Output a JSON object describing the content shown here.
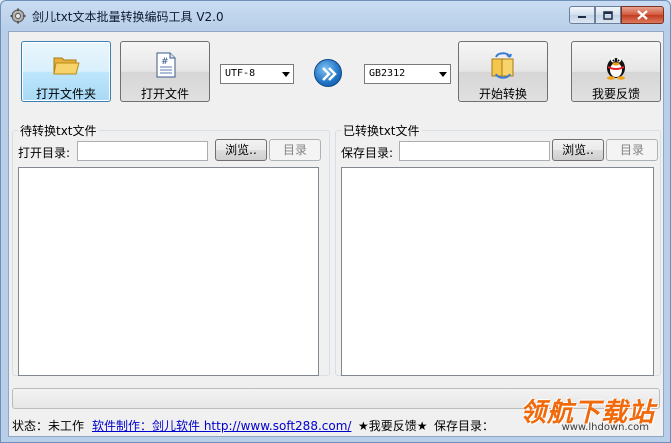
{
  "window": {
    "title": "剑儿txt文本批量转换编码工具 V2.0"
  },
  "toolbar": {
    "open_folder_label": "打开文件夹",
    "open_file_label": "打开文件",
    "source_encoding": "UTF-8",
    "target_encoding": "GB2312",
    "start_convert_label": "开始转换",
    "feedback_label": "我要反馈"
  },
  "left_panel": {
    "title": "待转换txt文件",
    "dir_label": "打开目录:",
    "dir_value": "",
    "browse_label": "浏览..",
    "dir_button_label": "目录"
  },
  "right_panel": {
    "title": "已转换txt文件",
    "dir_label": "保存目录:",
    "dir_value": "",
    "browse_label": "浏览..",
    "dir_button_label": "目录"
  },
  "progress": {
    "value": 0
  },
  "status": {
    "state": "状态：未工作",
    "credit_link": "软件制作：剑儿软件  http://www.soft288.com/",
    "feedback": "★我要反馈★",
    "save_dir": "保存目录："
  },
  "watermark": {
    "text": "领航下载站",
    "url": "www.lhdown.com"
  },
  "colors": {
    "accent": "#3c7fb1",
    "link": "#0000cc",
    "watermark": "#f06a0c"
  }
}
